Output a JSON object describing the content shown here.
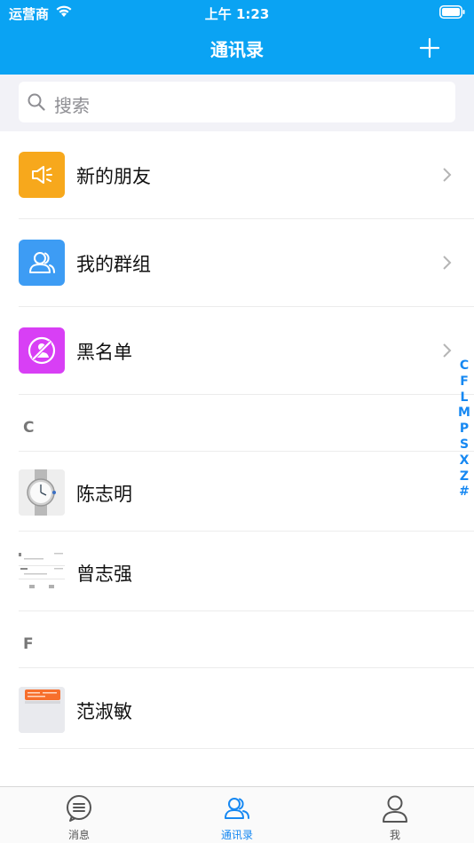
{
  "status_bar": {
    "carrier": "运营商",
    "time": "上午 1:23"
  },
  "nav": {
    "title": "通讯录",
    "add_icon": "plus-icon"
  },
  "search": {
    "placeholder": "搜索",
    "icon": "search-icon"
  },
  "menu": [
    {
      "label": "新的朋友",
      "icon": "megaphone-icon",
      "color": "#f7a81c"
    },
    {
      "label": "我的群组",
      "icon": "group-icon",
      "color": "#3d9cf4"
    },
    {
      "label": "黑名单",
      "icon": "block-user-icon",
      "color": "#d83ff5"
    }
  ],
  "sections": [
    {
      "letter": "C",
      "contacts": [
        {
          "name": "陈志明",
          "avatar": "watch-photo"
        },
        {
          "name": "曾志强",
          "avatar": "document-screenshot"
        }
      ]
    },
    {
      "letter": "F",
      "contacts": [
        {
          "name": "范淑敏",
          "avatar": "app-screenshot"
        }
      ]
    }
  ],
  "index_letters": [
    "C",
    "F",
    "L",
    "M",
    "P",
    "S",
    "X",
    "Z",
    "#"
  ],
  "tabs": [
    {
      "label": "消息",
      "icon": "message-icon",
      "active": false
    },
    {
      "label": "通讯录",
      "icon": "contacts-icon",
      "active": true
    },
    {
      "label": "我",
      "icon": "profile-icon",
      "active": false
    }
  ],
  "colors": {
    "header": "#0aa3f3",
    "accent": "#1688f2"
  }
}
